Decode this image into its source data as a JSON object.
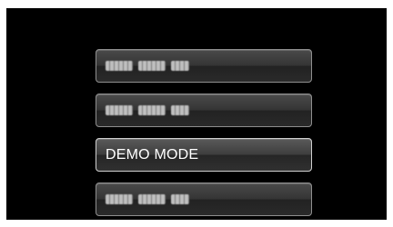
{
  "menu": {
    "items": [
      {
        "label": "",
        "state": "blurred"
      },
      {
        "label": "",
        "state": "blurred"
      },
      {
        "label": "DEMO MODE",
        "state": "selected"
      },
      {
        "label": "",
        "state": "blurred"
      }
    ]
  },
  "colors": {
    "background": "#000000",
    "item_border": "#8f8f8f",
    "selected_border": "#d0d0d0",
    "text": "#ffffff"
  }
}
